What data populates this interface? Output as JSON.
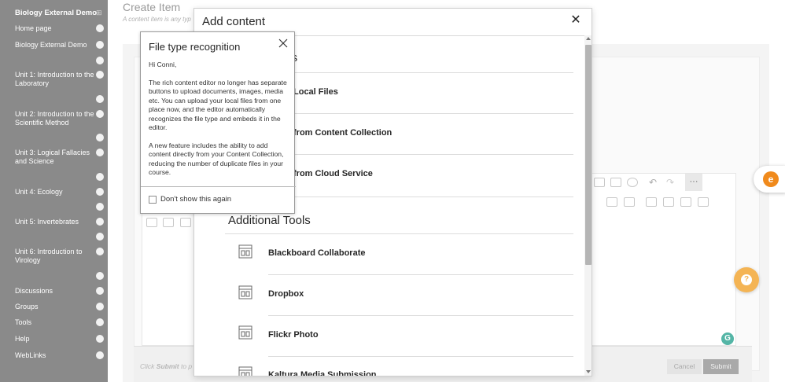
{
  "sidebar": {
    "course_title": "Biology External Demo",
    "items": [
      {
        "label": "Home page"
      },
      {
        "label": "Biology External Demo"
      },
      {
        "label": "Unit 1: Introduction to the Laboratory"
      },
      {
        "label": "Unit 2: Introduction to the Scientific Method"
      },
      {
        "label": "Unit 3: Logical Fallacies and Science"
      },
      {
        "label": "Unit 4: Ecology"
      },
      {
        "label": "Unit 5: Invertebrates"
      },
      {
        "label": "Unit 6: Introduction to Virology"
      },
      {
        "label": "Discussions"
      },
      {
        "label": "Groups"
      },
      {
        "label": "Tools"
      },
      {
        "label": "Help"
      },
      {
        "label": "WebLinks"
      }
    ]
  },
  "page": {
    "title": "Create Item",
    "subtitle": "A content item is any typ",
    "footer_hint_prefix": "Click",
    "footer_hint_bold": "Submit",
    "footer_hint_suffix": "to p",
    "cancel_label": "Cancel",
    "submit_label": "Submit",
    "more_label": "···",
    "grammarly_badge": "G"
  },
  "modal": {
    "title": "Add content",
    "close_label": "✕",
    "section1_title_fragment": "ols",
    "section1_items": [
      {
        "label": "Local Files"
      },
      {
        "label": "from Content Collection"
      },
      {
        "label": "from Cloud Service"
      }
    ],
    "section2_title": "Additional Tools",
    "section2_items": [
      {
        "label": "Blackboard Collaborate",
        "icon": "embed-tool-icon"
      },
      {
        "label": "Dropbox",
        "icon": "embed-tool-icon"
      },
      {
        "label": "Flickr Photo",
        "icon": "embed-tool-icon"
      },
      {
        "label": "Kaltura Media Submission",
        "icon": "embed-tool-icon"
      }
    ]
  },
  "popover": {
    "title": "File type recognition",
    "greeting": "Hi Conni,",
    "paragraph1": "The rich content editor no longer has separate buttons to upload documents, images, media etc. You can upload your local files from one place now, and the editor automatically recognizes the file type and embeds it in the editor.",
    "paragraph2": "A new feature includes the ability to add content directly from your Content Collection, reducing the number of duplicate files in your course.",
    "checkbox_label": "Don't show this again"
  },
  "widgets": {
    "float_tab_icon": "e",
    "help_icon": "?"
  },
  "colors": {
    "sidebar_bg": "#8a8a8a",
    "accent_orange": "#f08a1c",
    "help_yellow": "#f4b454",
    "grammarly_green": "#54b5a6"
  }
}
